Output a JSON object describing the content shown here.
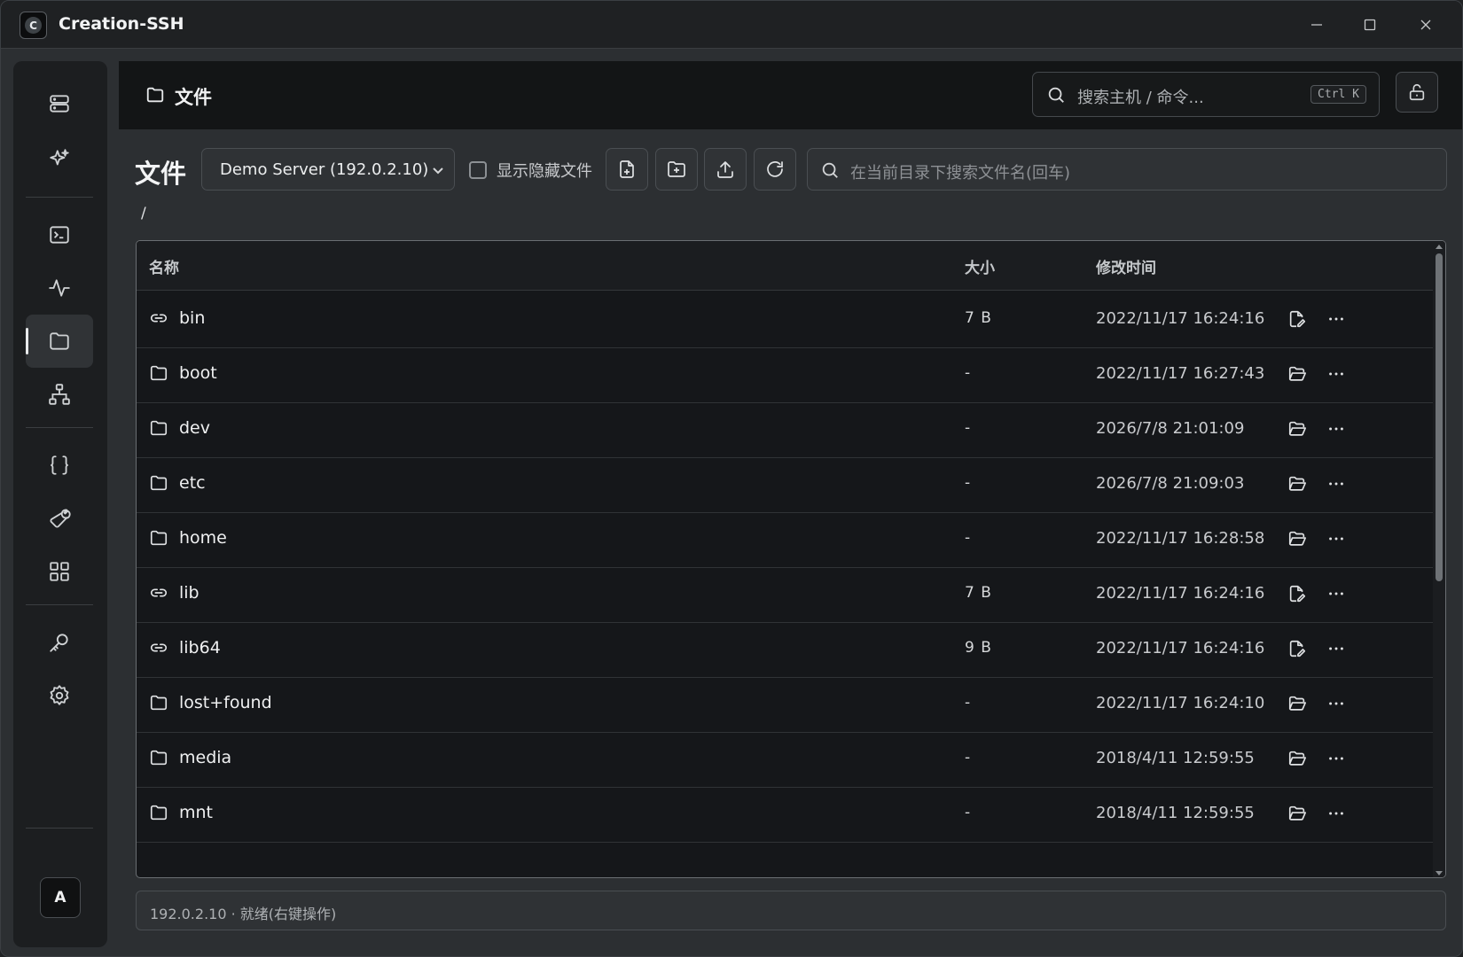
{
  "app": {
    "title": "Creation-SSH",
    "logo_letter": "C"
  },
  "window_controls": [
    "minimize-icon",
    "maximize-icon",
    "close-icon"
  ],
  "sidebar": {
    "items": [
      {
        "name": "servers",
        "icon": "server-icon",
        "active": false
      },
      {
        "name": "ai",
        "icon": "sparkle-icon",
        "active": false
      },
      {
        "name": "terminal",
        "icon": "terminal-icon",
        "active": false
      },
      {
        "name": "monitor",
        "icon": "activity-icon",
        "active": false
      },
      {
        "name": "files",
        "icon": "folder-icon",
        "active": true
      },
      {
        "name": "network",
        "icon": "network-icon",
        "active": false
      },
      {
        "name": "snippets",
        "icon": "braces-icon",
        "active": false
      },
      {
        "name": "tools",
        "icon": "wrench-icon",
        "active": false
      },
      {
        "name": "apps",
        "icon": "grid-icon",
        "active": false
      },
      {
        "name": "keys",
        "icon": "key-icon",
        "active": false
      },
      {
        "name": "settings",
        "icon": "gear-icon",
        "active": false
      }
    ],
    "avatar_letter": "A"
  },
  "header": {
    "title": "文件",
    "search_placeholder": "搜索主机 / 命令...",
    "shortcut": "Ctrl K"
  },
  "toolbar": {
    "page_title": "文件",
    "server_selected": "Demo Server (192.0.2.10)",
    "show_hidden_label": "显示隐藏文件",
    "show_hidden_checked": false,
    "buttons": [
      "new-file-icon",
      "new-folder-icon",
      "upload-icon",
      "refresh-icon"
    ],
    "search_placeholder": "在当前目录下搜索文件名(回车)"
  },
  "breadcrumb": "/",
  "table": {
    "columns": {
      "name": "名称",
      "size": "大小",
      "modified": "修改时间"
    },
    "rows": [
      {
        "type": "link",
        "name": "bin",
        "size": "7 B",
        "modified": "2022/11/17 16:24:16"
      },
      {
        "type": "folder",
        "name": "boot",
        "size": "-",
        "modified": "2022/11/17 16:27:43"
      },
      {
        "type": "folder",
        "name": "dev",
        "size": "-",
        "modified": "2026/7/8 21:01:09"
      },
      {
        "type": "folder",
        "name": "etc",
        "size": "-",
        "modified": "2026/7/8 21:09:03"
      },
      {
        "type": "folder",
        "name": "home",
        "size": "-",
        "modified": "2022/11/17 16:28:58"
      },
      {
        "type": "link",
        "name": "lib",
        "size": "7 B",
        "modified": "2022/11/17 16:24:16"
      },
      {
        "type": "link",
        "name": "lib64",
        "size": "9 B",
        "modified": "2022/11/17 16:24:16"
      },
      {
        "type": "folder",
        "name": "lost+found",
        "size": "-",
        "modified": "2022/11/17 16:24:10"
      },
      {
        "type": "folder",
        "name": "media",
        "size": "-",
        "modified": "2018/4/11 12:59:55"
      },
      {
        "type": "folder",
        "name": "mnt",
        "size": "-",
        "modified": "2018/4/11 12:59:55"
      }
    ]
  },
  "status": "192.0.2.10 · 就绪(右键操作)"
}
